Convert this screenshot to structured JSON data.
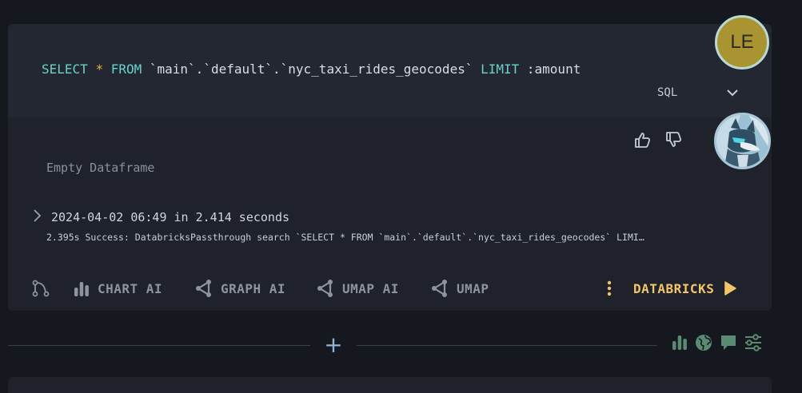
{
  "query": {
    "parts": [
      {
        "text": "SELECT",
        "cls": "kw"
      },
      {
        "text": " ",
        "cls": ""
      },
      {
        "text": "*",
        "cls": "op"
      },
      {
        "text": " ",
        "cls": ""
      },
      {
        "text": "FROM",
        "cls": "kw"
      },
      {
        "text": " `main`.`default`.`nyc_taxi_rides_geocodes` ",
        "cls": ""
      },
      {
        "text": "LIMIT",
        "cls": "kw"
      },
      {
        "text": " :amount",
        "cls": ""
      }
    ],
    "language": "SQL"
  },
  "result": {
    "empty_label": "Empty Dataframe",
    "timestamp": "2024-04-02 06:49 in 2.414 seconds",
    "log": "2.395s Success: DatabricksPassthrough search `SELECT * FROM `main`.`default`.`nyc_taxi_rides_geocodes` LIMI…"
  },
  "toolbar": {
    "chart_ai": "CHART AI",
    "graph_ai": "GRAPH AI",
    "umap_ai": "UMAP AI",
    "umap": "UMAP",
    "databricks": "DATABRICKS"
  },
  "user": {
    "initials": "LE"
  },
  "add_cell": {
    "label": "+"
  },
  "colors": {
    "keyword": "#6ad2c9",
    "operator": "#e3b341",
    "accent": "#f3c56a",
    "avatar_bg": "#aa9431"
  }
}
